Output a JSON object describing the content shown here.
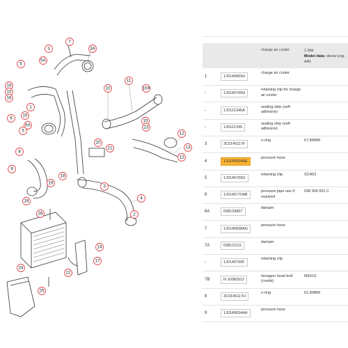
{
  "header": {
    "description": "charge air cooler",
    "year": "1.9tdi",
    "model_label": "Model data:",
    "model_value": "diesel eng.: ARL"
  },
  "rows": [
    {
      "pos": "1",
      "part": "1J0145803H",
      "desc": "charge air cooler",
      "note": "",
      "highlight": false
    },
    {
      "pos": "-",
      "part": "1J0145769H",
      "desc": "retaining clip for charge air cooler",
      "note": "",
      "highlight": false
    },
    {
      "pos": "-",
      "part": "1J0121345A",
      "desc": "sealing strip (self-adhesive)",
      "note": "",
      "highlight": false
    },
    {
      "pos": "-",
      "part": "1J0121345",
      "desc": "sealing strip (self-adhesive)",
      "note": "",
      "highlight": false
    },
    {
      "pos": "3",
      "part": "3C0145117F",
      "desc": "o-ring",
      "note": "57,85MM",
      "highlight": false
    },
    {
      "pos": "4",
      "part": "1J0145834AE",
      "desc": "pressure hose",
      "note": "",
      "highlight": true
    },
    {
      "pos": "5",
      "part": "1J0145769G",
      "desc": "retaining clip",
      "note": "SCA52",
      "highlight": false
    },
    {
      "pos": "6",
      "part": "1J0145770AB",
      "desc": "pressure pipe use if required",
      "note": "038 906 051 C",
      "highlight": false
    },
    {
      "pos": "6A",
      "part": "038129807",
      "desc": "damper",
      "note": "",
      "highlight": false
    },
    {
      "pos": "7",
      "part": "1J0145838AG",
      "desc": "pressure hose",
      "note": "",
      "highlight": false
    },
    {
      "pos": "7A",
      "part": "038131111",
      "desc": "damper",
      "note": "",
      "highlight": false
    },
    {
      "pos": "-",
      "part": "1J0145769F",
      "desc": "retaining clip",
      "note": "",
      "highlight": false
    },
    {
      "pos": "7B",
      "part": "N 10082912",
      "desc": "hexagon head bolt (combi)",
      "note": "M6X16",
      "highlight": false
    },
    {
      "pos": "8",
      "part": "3C0145117H",
      "desc": "o-ring",
      "note": "61,90MM",
      "highlight": false
    },
    {
      "pos": "9",
      "part": "1J0145834AA",
      "desc": "pressure hose",
      "note": "",
      "highlight": false
    }
  ],
  "callouts": [
    "7",
    "3",
    "3A",
    "5",
    "5A",
    "19",
    "15",
    "16",
    "1",
    "15",
    "6",
    "6A",
    "5",
    "11",
    "10",
    "10A",
    "15",
    "23",
    "12",
    "12",
    "13",
    "20",
    "21",
    "8",
    "9",
    "19",
    "18",
    "3",
    "4",
    "2",
    "26",
    "14",
    "17",
    "24",
    "25",
    "22",
    "18"
  ],
  "colors": {
    "callout": "#e0474c",
    "highlight": "#f9b233",
    "header_bg": "#e9e9e9"
  }
}
